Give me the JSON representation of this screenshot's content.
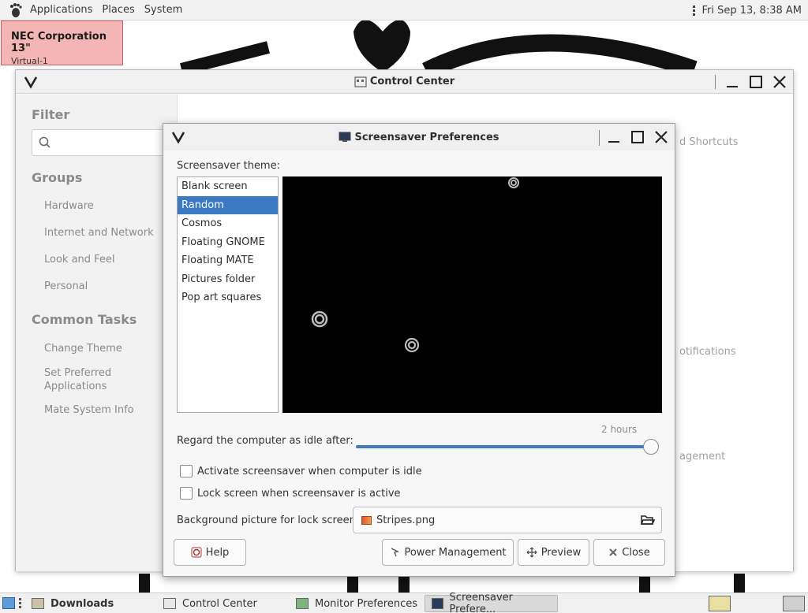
{
  "top_panel": {
    "menus": [
      "Applications",
      "Places",
      "System"
    ],
    "clock": "Fri Sep 13,  8:38 AM"
  },
  "monitor_badge": {
    "name": "NEC Corporation 13\"",
    "connector": "Virtual-1"
  },
  "control_center": {
    "title": "Control Center",
    "filter_label": "Filter",
    "filter_placeholder": "",
    "groups_title": "Groups",
    "groups": [
      "Hardware",
      "Internet and Network",
      "Look and Feel",
      "Personal"
    ],
    "common_tasks_title": "Common Tasks",
    "common_tasks": [
      "Change Theme",
      "Set Preferred Applications",
      "Mate System Info"
    ],
    "background_fragments": [
      "d Shortcuts",
      "otifications",
      "agement"
    ]
  },
  "screensaver": {
    "title": "Screensaver Preferences",
    "theme_label": "Screensaver theme:",
    "themes": [
      "Blank screen",
      "Random",
      "Cosmos",
      "Floating GNOME",
      "Floating MATE",
      "Pictures folder",
      "Pop art squares"
    ],
    "selected_theme": "Random",
    "idle_label": "Regard the computer as idle after:",
    "idle_value": "2 hours",
    "idle_fraction": 1.0,
    "activate_label": "Activate screensaver when computer is idle",
    "activate_checked": false,
    "lock_label": "Lock screen when screensaver is active",
    "lock_checked": false,
    "bg_label": "Background picture for lock screen:",
    "bg_file": "Stripes.png",
    "buttons": {
      "help": "Help",
      "power": "Power Management",
      "preview": "Preview",
      "close": "Close"
    }
  },
  "taskbar": {
    "items": [
      "Downloads",
      "Control Center",
      "Monitor Preferences",
      "Screensaver Prefere..."
    ],
    "active": "Screensaver Prefere..."
  },
  "colors": {
    "accent": "#3c7ac4",
    "badge_bg": "#f4b5b5"
  }
}
